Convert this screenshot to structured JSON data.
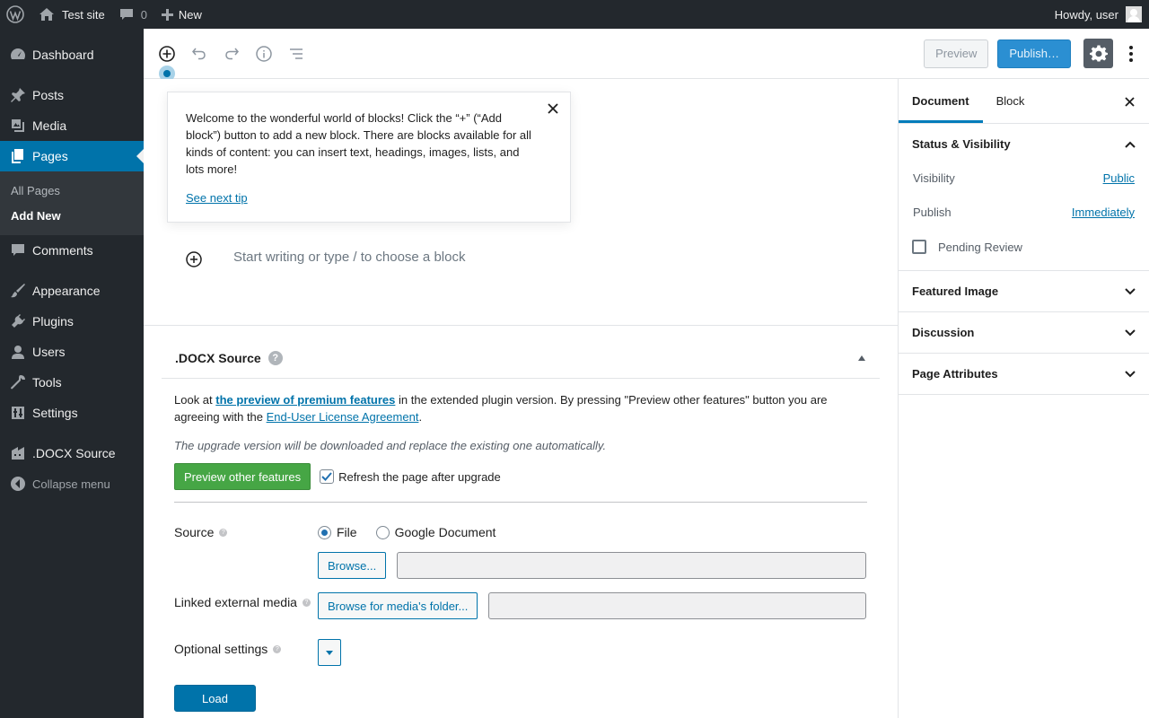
{
  "adminbar": {
    "site_name": "Test site",
    "comment_count": "0",
    "new_label": "New",
    "howdy": "Howdy, user"
  },
  "menu": {
    "items": [
      {
        "label": "Dashboard",
        "icon": "dashboard-icon"
      },
      {
        "label": "Posts",
        "icon": "pin-icon"
      },
      {
        "label": "Media",
        "icon": "media-icon"
      },
      {
        "label": "Pages",
        "icon": "pages-icon"
      },
      {
        "label": "Comments",
        "icon": "comment-icon"
      },
      {
        "label": "Appearance",
        "icon": "brush-icon"
      },
      {
        "label": "Plugins",
        "icon": "plug-icon"
      },
      {
        "label": "Users",
        "icon": "user-icon"
      },
      {
        "label": "Tools",
        "icon": "wrench-icon"
      },
      {
        "label": "Settings",
        "icon": "settings-icon"
      },
      {
        "label": ".DOCX Source",
        "icon": "building-icon"
      }
    ],
    "submenu": [
      "All Pages",
      "Add New"
    ],
    "collapse": "Collapse menu"
  },
  "toolbar": {
    "preview_label": "Preview",
    "publish_label": "Publish…"
  },
  "tip": {
    "text": "Welcome to the wonderful world of blocks! Click the “+” (“Add block”) button to add a new block. There are blocks available for all kinds of content: you can insert text, headings, images, lists, and lots more!",
    "next": "See next tip"
  },
  "editor": {
    "placeholder": "Start writing or type / to choose a block"
  },
  "metabox": {
    "title": ".DOCX Source",
    "intro_before": "Look at ",
    "intro_link": "the preview of premium features",
    "intro_middle": " in the extended plugin version. By pressing \"Preview other features\" button you are agreeing with the ",
    "intro_link2": "End-User License Agreement",
    "intro_after": ".",
    "note": "The upgrade version will be downloaded and replace the existing one automatically.",
    "preview_button": "Preview other features",
    "refresh_label": "Refresh the page after upgrade",
    "source_label": "Source",
    "source_options": [
      "File",
      "Google Document"
    ],
    "browse_label": "Browse...",
    "linked_label": "Linked external media",
    "browse_media_label": "Browse for media's folder...",
    "optional_label": "Optional settings",
    "load_label": "Load"
  },
  "sidebar": {
    "tabs": [
      "Document",
      "Block"
    ],
    "status_title": "Status & Visibility",
    "visibility_label": "Visibility",
    "visibility_value": "Public",
    "publish_label": "Publish",
    "publish_value": "Immediately",
    "pending_label": "Pending Review",
    "panels": [
      "Featured Image",
      "Discussion",
      "Page Attributes"
    ]
  }
}
